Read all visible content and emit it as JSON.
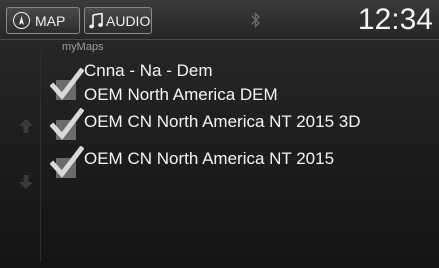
{
  "topbar": {
    "map_label": "MAP",
    "audio_label": "AUDIO",
    "clock": "12:34"
  },
  "main": {
    "section_title": "myMaps",
    "items": [
      {
        "line1": "Cnna - Na - Dem",
        "line2": "OEM North America DEM",
        "checked": true
      },
      {
        "line1": "OEM CN North America NT 2015 3D",
        "checked": true
      },
      {
        "line1": "OEM CN North America NT 2015",
        "checked": true
      }
    ]
  },
  "icons": {
    "map": "compass-icon",
    "audio": "music-note-icon",
    "bluetooth": "bluetooth-icon",
    "check": "checkmark-icon",
    "up": "scroll-up-icon",
    "down": "scroll-down-icon"
  }
}
